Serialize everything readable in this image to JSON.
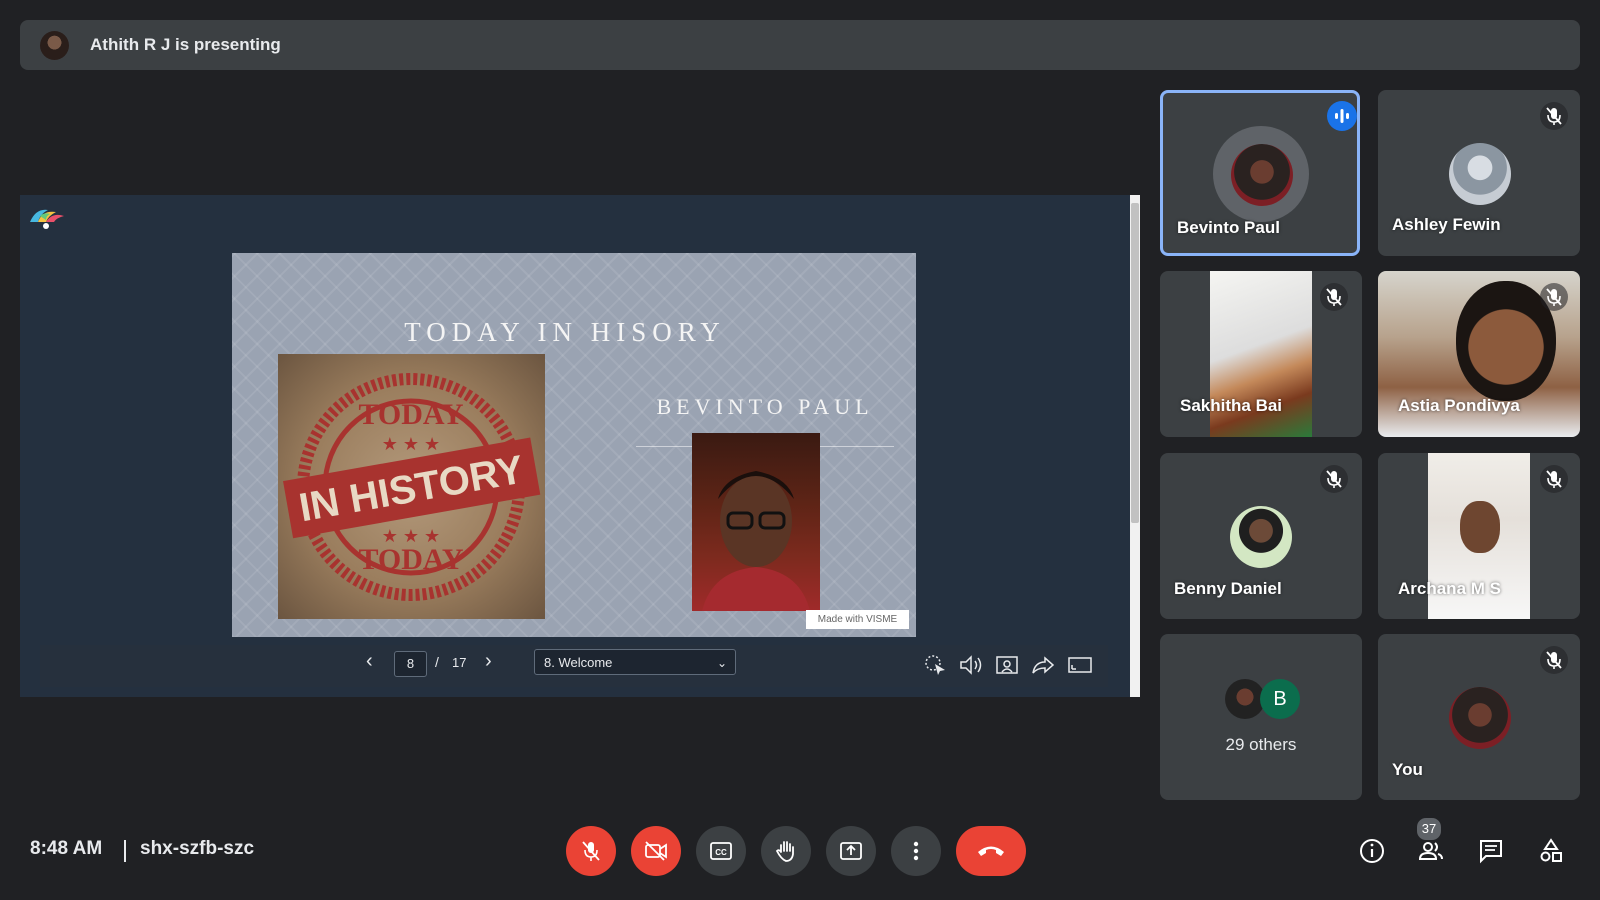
{
  "banner": {
    "text": "Athith R J is presenting"
  },
  "presentation": {
    "slide_title": "TODAY IN HISORY",
    "stamp_top": "TODAY",
    "stamp_middle": "IN HISTORY",
    "stamp_bottom": "TODAY",
    "presenter_name": "BEVINTO PAUL",
    "made_with": "Made with VISME",
    "current_page": "8",
    "page_separator": "/",
    "total_pages": "17",
    "selected_slide": "8. Welcome"
  },
  "participants": [
    {
      "name": "Bevinto Paul",
      "speaking": true
    },
    {
      "name": "Ashley Fewin",
      "muted": true
    },
    {
      "name": "Sakhitha Bai",
      "muted": true
    },
    {
      "name": "Astia Pondivya",
      "muted": true
    },
    {
      "name": "Benny Daniel",
      "muted": true
    },
    {
      "name": "Archana M S",
      "muted": true
    },
    {
      "name": "29 others",
      "avatar_letter": "B"
    },
    {
      "name": "You",
      "muted": true
    }
  ],
  "meeting": {
    "time": "8:48 AM",
    "code": "shx-szfb-szc",
    "people_count": "37"
  },
  "colors": {
    "background": "#202124",
    "tile": "#3c4043",
    "active_border": "#8ab4f8",
    "danger": "#ea4335",
    "speaking": "#1a73e8",
    "others_avatar": "#0b6d4d"
  },
  "icons": [
    "mic-off-icon",
    "video-off-icon",
    "captions-icon",
    "raise-hand-icon",
    "present-icon",
    "more-icon",
    "end-call-icon",
    "info-icon",
    "people-icon",
    "chat-icon",
    "activities-icon"
  ]
}
